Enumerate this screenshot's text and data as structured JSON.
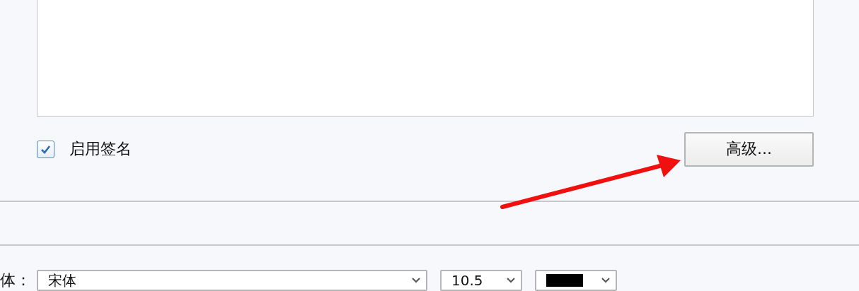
{
  "signature_editor": {
    "kind": "textarea"
  },
  "enable_signature": {
    "label": "启用签名",
    "checked": true
  },
  "advanced_button": {
    "label": "高级..."
  },
  "font_row": {
    "label": "体：",
    "font": "宋体",
    "size": "10.5"
  }
}
